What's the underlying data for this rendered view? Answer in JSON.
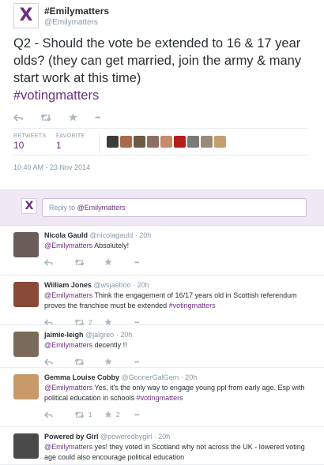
{
  "tweet": {
    "author_name": "#Emilymatters",
    "author_handle": "@Emilymatters",
    "avatar_letter": "X",
    "text": "Q2 - Should the vote be extended to 16 & 17 year olds? (they can get married, join the army & many start work at this time)",
    "hashtag": "#votingmatters",
    "timestamp": "10:40 AM - 23 Nov 2014",
    "stats": {
      "retweets_label": "RETWEETS",
      "retweets_value": "10",
      "favorites_label": "FAVORITE",
      "favorites_value": "1"
    },
    "more_label": "•••"
  },
  "reply_box": {
    "prefix": "Reply to ",
    "mention": "@Emilymatters",
    "avatar_letter": "X"
  },
  "colors": {
    "accent": "#6b2f7f",
    "muted": "#8899a6",
    "reply_band": "#f0e9f5"
  },
  "fav_avatar_colors": [
    "#3a3a3a",
    "#a86b4a",
    "#6e5a44",
    "#8d6e63",
    "#c48a6a",
    "#b71c1c",
    "#7a7a7a",
    "#9a8a7a",
    "#c4a070"
  ],
  "replies": [
    {
      "name": "Nicola Gauld",
      "handle": "@nicolagauld",
      "time": "· 20h",
      "mention": "@Emilymatters",
      "text": " Absolutely!",
      "hashtag": "",
      "retweets": "",
      "favorites": "",
      "photo_color": "#6a5d5a"
    },
    {
      "name": "William Jones",
      "handle": "@wsjaeboo",
      "time": "· 20h",
      "mention": "@Emilymatters",
      "text": "  Think the engagement of 16/17 years old in Scottish referendum proves the franchise must be extended ",
      "hashtag": "#votingmatters",
      "retweets": "2",
      "favorites": "",
      "photo_color": "#8a4a3a"
    },
    {
      "name": "jaimie-leigh",
      "handle": "@jalgreo",
      "time": "· 20h",
      "mention": "@Emilymatters",
      "text": " decently !!",
      "hashtag": "",
      "retweets": "",
      "favorites": "",
      "photo_color": "#7a6a5a"
    },
    {
      "name": "Gemma Louise Cobby",
      "handle": "@GoonerGalGem",
      "time": "· 20h",
      "mention": "@Emilymatters",
      "text": " Yes, it's the only way to engage young ppl from early age. Esp with political education in schools ",
      "hashtag": "#votingmatters",
      "retweets": "1",
      "favorites": "2",
      "photo_color": "#c89a6a"
    },
    {
      "name": "Powered by Girl",
      "handle": "@poweredbygirl",
      "time": "· 20h",
      "mention": "@Emilymatters",
      "text": " yes! they voted in Scotland why not across the UK - lowered voting age could also encourage political education",
      "hashtag": "",
      "retweets": "",
      "favorites": "",
      "photo_color": "#4a4a4a"
    }
  ]
}
